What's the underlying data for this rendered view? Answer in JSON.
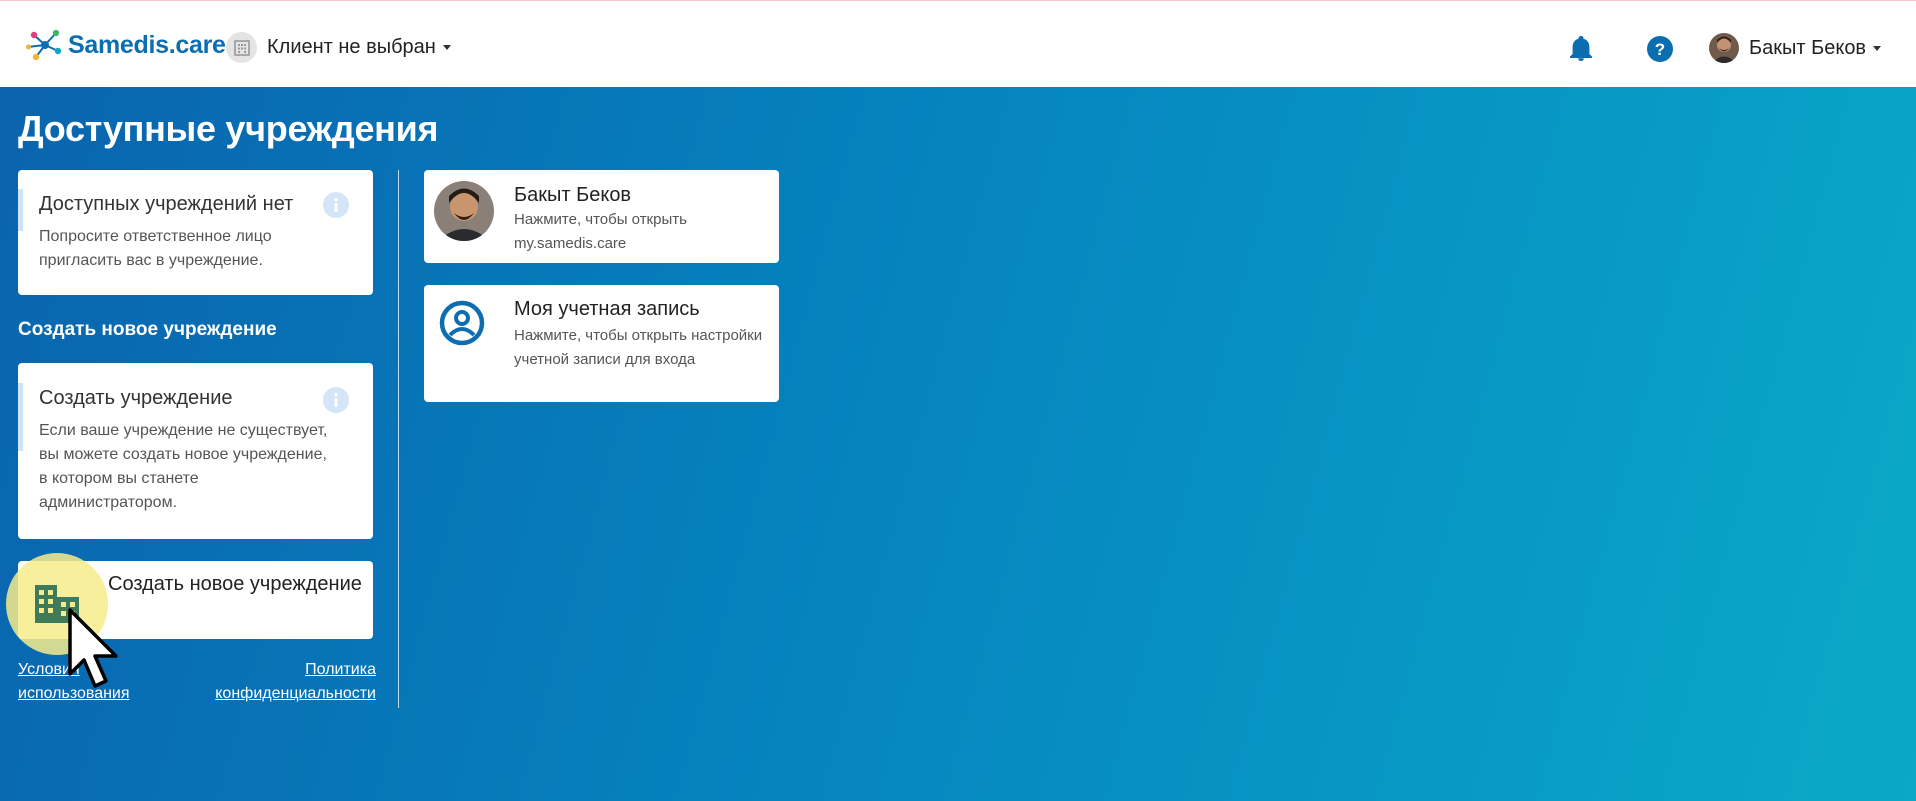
{
  "header": {
    "logo_text": "Samedis.care",
    "client_select_label": "Клиент не выбран",
    "user_name": "Бакыт Беков",
    "icons": {
      "logo": "samedis-network-logo",
      "client": "building-icon",
      "notifications": "bell-icon",
      "help": "help-icon",
      "avatar": "user-avatar-photo"
    }
  },
  "main": {
    "title": "Доступные учреждения",
    "no_facilities_card": {
      "title": "Доступных учреждений нет",
      "text": "Попросите ответственное лицо пригласить вас в учреждение."
    },
    "create_section_heading": "Создать новое учреждение",
    "create_info_card": {
      "title": "Создать учреждение",
      "text": "Если ваше учреждение не существует, вы можете создать новое учреждение, в котором вы станете администратором."
    },
    "create_button_label": "Создать новое учреждение",
    "footer": {
      "terms_link": "Условия использования",
      "privacy_link": "Политика конфиденциальности"
    }
  },
  "right": {
    "profile_card": {
      "title": "Бакыт Беков",
      "text": "Нажмите, чтобы открыть my.samedis.care"
    },
    "account_card": {
      "title": "Моя учетная запись",
      "text": "Нажмите, чтобы открыть настройки учетной записи для входа"
    }
  },
  "colors": {
    "brand_blue": "#0c6eb1",
    "gradient_start": "#0a63ad",
    "gradient_end": "#0aa9c8",
    "info_accent": "#cfe3f7",
    "highlight": "#f7ec8c"
  }
}
